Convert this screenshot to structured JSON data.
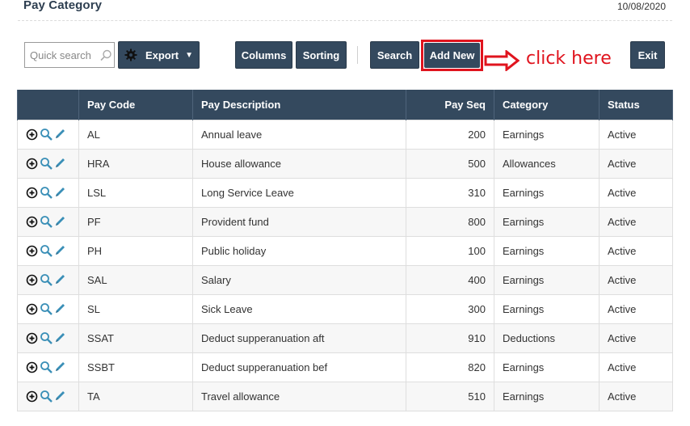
{
  "header": {
    "title": "Pay Category",
    "date": "10/08/2020"
  },
  "toolbar": {
    "quick_search_placeholder": "Quick search",
    "export_label": "Export",
    "columns_label": "Columns",
    "sorting_label": "Sorting",
    "search_label": "Search",
    "add_new_label": "Add New",
    "exit_label": "Exit"
  },
  "annotation": {
    "callout_text": "click here",
    "color": "#e0141e"
  },
  "colors": {
    "header_bg": "#34495e",
    "button_bg": "#34495e",
    "icon_teal": "#3a8fb7"
  },
  "table": {
    "columns": [
      "",
      "Pay Code",
      "Pay Description",
      "Pay Seq",
      "Category",
      "Status"
    ],
    "rows": [
      {
        "code": "AL",
        "description": "Annual leave",
        "seq": "200",
        "category": "Earnings",
        "status": "Active"
      },
      {
        "code": "HRA",
        "description": "House allowance",
        "seq": "500",
        "category": "Allowances",
        "status": "Active"
      },
      {
        "code": "LSL",
        "description": "Long Service Leave",
        "seq": "310",
        "category": "Earnings",
        "status": "Active"
      },
      {
        "code": "PF",
        "description": "Provident fund",
        "seq": "800",
        "category": "Earnings",
        "status": "Active"
      },
      {
        "code": "PH",
        "description": "Public holiday",
        "seq": "100",
        "category": "Earnings",
        "status": "Active"
      },
      {
        "code": "SAL",
        "description": "Salary",
        "seq": "400",
        "category": "Earnings",
        "status": "Active"
      },
      {
        "code": "SL",
        "description": "Sick Leave",
        "seq": "300",
        "category": "Earnings",
        "status": "Active"
      },
      {
        "code": "SSAT",
        "description": "Deduct supperanuation aft",
        "seq": "910",
        "category": "Deductions",
        "status": "Active"
      },
      {
        "code": "SSBT",
        "description": "Deduct supperanuation bef",
        "seq": "820",
        "category": "Earnings",
        "status": "Active"
      },
      {
        "code": "TA",
        "description": "Travel allowance",
        "seq": "510",
        "category": "Earnings",
        "status": "Active"
      }
    ],
    "row_actions": [
      "expand-icon",
      "view-icon",
      "edit-icon"
    ]
  }
}
